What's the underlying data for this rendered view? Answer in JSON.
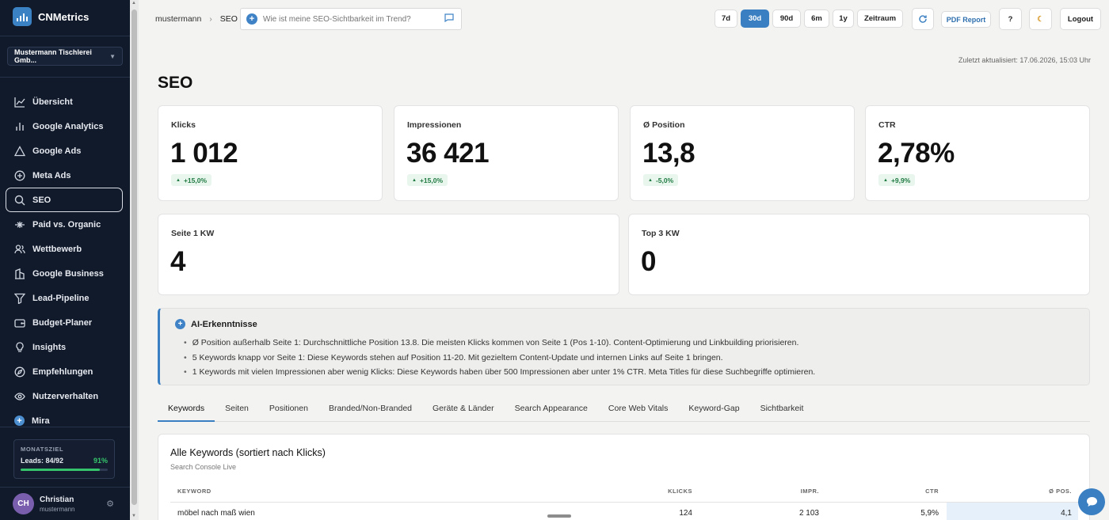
{
  "app": {
    "name": "CNMetrics"
  },
  "client": {
    "selected": "Mustermann Tischlerei Gmb..."
  },
  "sidebar": {
    "items": [
      {
        "label": "Übersicht",
        "icon": "line-chart-icon"
      },
      {
        "label": "Google Analytics",
        "icon": "bar-chart-icon"
      },
      {
        "label": "Google Ads",
        "icon": "triangle-icon"
      },
      {
        "label": "Meta Ads",
        "icon": "plus-circle-icon"
      },
      {
        "label": "SEO",
        "icon": "search-icon",
        "active": true
      },
      {
        "label": "Paid vs. Organic",
        "icon": "split-icon"
      },
      {
        "label": "Wettbewerb",
        "icon": "users-icon"
      },
      {
        "label": "Google Business",
        "icon": "building-icon"
      },
      {
        "label": "Lead-Pipeline",
        "icon": "funnel-icon"
      },
      {
        "label": "Budget-Planer",
        "icon": "wallet-icon"
      },
      {
        "label": "Insights",
        "icon": "lightbulb-icon"
      },
      {
        "label": "Empfehlungen",
        "icon": "compass-icon"
      },
      {
        "label": "Nutzerverhalten",
        "icon": "eye-icon"
      },
      {
        "label": "Mira",
        "icon": "mira-icon"
      }
    ],
    "goal": {
      "label": "MONATSZIEL",
      "leads": "Leads: 84/92",
      "percent": "91%",
      "progress": 0.91
    },
    "user": {
      "initials": "CH",
      "name": "Christian",
      "handle": "mustermann"
    }
  },
  "header": {
    "breadcrumb": [
      "mustermann",
      "SEO"
    ],
    "ask_placeholder": "Wie ist meine SEO-Sichtbarkeit im Trend?",
    "periods": [
      {
        "label": "7d"
      },
      {
        "label": "30d",
        "active": true
      },
      {
        "label": "90d"
      },
      {
        "label": "6m"
      },
      {
        "label": "1y"
      },
      {
        "label": "Zeitraum"
      }
    ],
    "pdf_label": "PDF Report",
    "help_label": "?",
    "logout_label": "Logout"
  },
  "main": {
    "updated": "Zuletzt aktualisiert: 17.06.2026, 15:03 Uhr",
    "title": "SEO",
    "kpis": [
      {
        "label": "Klicks",
        "value": "1 012",
        "delta": "+15,0%"
      },
      {
        "label": "Impressionen",
        "value": "36 421",
        "delta": "+15,0%"
      },
      {
        "label": "Ø Position",
        "value": "13,8",
        "delta": "-5,0%"
      },
      {
        "label": "CTR",
        "value": "2,78%",
        "delta": "+9,9%"
      }
    ],
    "kpis2": [
      {
        "label": "Seite 1 KW",
        "value": "4"
      },
      {
        "label": "Top 3 KW",
        "value": "0"
      }
    ],
    "insight": {
      "title": "AI-Erkenntnisse",
      "items": [
        "Ø Position außerhalb Seite 1: Durchschnittliche Position 13.8. Die meisten Klicks kommen von Seite 1 (Pos 1-10). Content-Optimierung und Linkbuilding priorisieren.",
        "5 Keywords knapp vor Seite 1: Diese Keywords stehen auf Position 11-20. Mit gezieltem Content-Update und internen Links auf Seite 1 bringen.",
        "1 Keywords mit vielen Impressionen aber wenig Klicks: Diese Keywords haben über 500 Impressionen aber unter 1% CTR. Meta Titles für diese Suchbegriffe optimieren."
      ]
    },
    "tabs": [
      "Keywords",
      "Seiten",
      "Positionen",
      "Branded/Non-Branded",
      "Geräte & Länder",
      "Search Appearance",
      "Core Web Vitals",
      "Keyword-Gap",
      "Sichtbarkeit"
    ],
    "table": {
      "title": "Alle Keywords (sortiert nach Klicks)",
      "subtitle": "Search Console Live",
      "columns": [
        "KEYWORD",
        "KLICKS",
        "IMPR.",
        "CTR",
        "Ø POS."
      ],
      "rows": [
        {
          "keyword": "möbel nach maß wien",
          "clicks": "124",
          "impr": "2 103",
          "ctr": "5,9%",
          "pos": "4,1"
        }
      ]
    }
  }
}
